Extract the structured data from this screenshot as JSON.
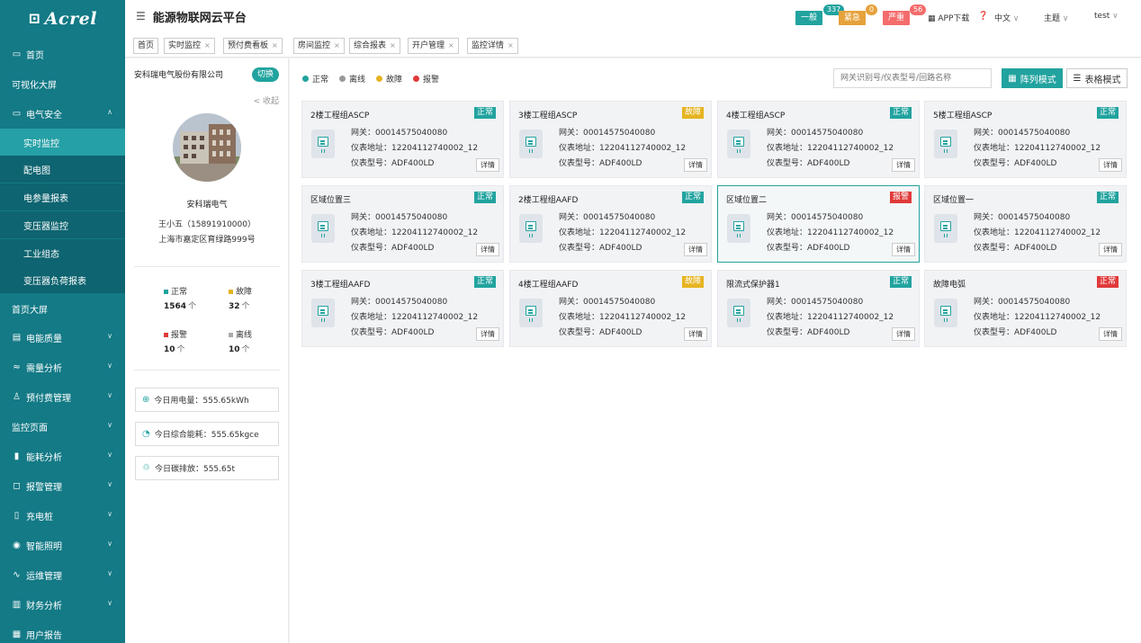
{
  "app": {
    "logo": "Acrel",
    "title": "能源物联网云平台"
  },
  "header": {
    "alarms": [
      {
        "label": "一般",
        "count": "337",
        "color": "#22a39f"
      },
      {
        "label": "紧急",
        "count": "0",
        "color": "#e6a23c"
      },
      {
        "label": "严重",
        "count": "56",
        "color": "#f56c6c"
      }
    ],
    "app_download": "APP下载",
    "language": "中文",
    "theme": "主题",
    "user": "test"
  },
  "sidebar": {
    "items": [
      {
        "label": "首页",
        "icon": "monitor-icon"
      },
      {
        "label": "可视化大屏"
      },
      {
        "label": "电气安全",
        "icon": "monitor-icon",
        "expanded": true
      },
      {
        "label": "实时监控",
        "sub": true,
        "active": true
      },
      {
        "label": "配电图",
        "sub": true
      },
      {
        "label": "电参量报表",
        "sub": true
      },
      {
        "label": "变压器监控",
        "sub": true
      },
      {
        "label": "工业组态",
        "sub": true
      },
      {
        "label": "变压器负荷报表",
        "sub": true
      },
      {
        "label": "首页大屏"
      },
      {
        "label": "电能质量",
        "icon": "wave-icon",
        "chevron": true
      },
      {
        "label": "需量分析",
        "icon": "trend-icon",
        "chevron": true
      },
      {
        "label": "预付费管理",
        "icon": "users-icon",
        "chevron": true
      },
      {
        "label": "监控页面",
        "chevron": true
      },
      {
        "label": "能耗分析",
        "icon": "bar-chart-icon",
        "chevron": true
      },
      {
        "label": "报警管理",
        "icon": "bell-icon",
        "chevron": true
      },
      {
        "label": "充电桩",
        "icon": "charger-icon",
        "chevron": true
      },
      {
        "label": "智能照明",
        "icon": "bulb-icon",
        "chevron": true
      },
      {
        "label": "运维管理",
        "icon": "pulse-icon",
        "chevron": true
      },
      {
        "label": "财务分析",
        "icon": "finance-icon",
        "chevron": true
      },
      {
        "label": "用户报告",
        "icon": "report-icon"
      }
    ]
  },
  "tabs": [
    {
      "label": "首页",
      "closable": false
    },
    {
      "label": "实时监控",
      "closable": true
    },
    {
      "label": "预付费看板",
      "closable": true
    },
    {
      "label": "房间监控",
      "closable": true
    },
    {
      "label": "综合报表",
      "closable": true
    },
    {
      "label": "开户管理",
      "closable": true
    },
    {
      "label": "监控详情",
      "closable": true
    }
  ],
  "left_panel": {
    "company": "安科瑞电气股份有限公司",
    "switch_label": "切换",
    "collapse_label": "< 收起",
    "profile_name": "安科瑞电气",
    "contact": "王小五（15891910000）",
    "address": "上海市嘉定区育绿路999号",
    "stats": [
      {
        "label": "正常",
        "value": "1564",
        "unit": "个",
        "color": "#22a39f"
      },
      {
        "label": "故障",
        "value": "32",
        "unit": "个",
        "color": "#e6b422"
      },
      {
        "label": "报警",
        "value": "10",
        "unit": "个",
        "color": "#e03a3a"
      },
      {
        "label": "离线",
        "value": "10",
        "unit": "个",
        "color": "#aaaaaa"
      }
    ],
    "info": [
      {
        "icon": "power-icon",
        "text": "今日用电量：555.65kWh"
      },
      {
        "icon": "gauge-icon",
        "text": "今日综合能耗：555.65kgce"
      },
      {
        "icon": "leaf-icon",
        "text": "今日碳排放：555.65t"
      }
    ]
  },
  "main": {
    "legend": [
      {
        "label": "正常",
        "color": "#22a39f"
      },
      {
        "label": "离线",
        "color": "#999999"
      },
      {
        "label": "故障",
        "color": "#e6b422"
      },
      {
        "label": "报警",
        "color": "#e03a3a"
      }
    ],
    "search_placeholder": "网关识别号/仪表型号/回路名称",
    "column_mode_label": "阵列模式",
    "table_mode_label": "表格模式",
    "cards": [
      {
        "name": "2楼工程组ASCP",
        "status": "正常",
        "status_color": "#22a39f",
        "gateway": "网关：00014575040080",
        "address": "仪表地址：12204112740002_12",
        "model": "仪表型号：ADF400LD",
        "detail": "详情"
      },
      {
        "name": "3楼工程组ASCP",
        "status": "故障",
        "status_color": "#e6b422",
        "gateway": "网关：00014575040080",
        "address": "仪表地址：12204112740002_12",
        "model": "仪表型号：ADF400LD",
        "detail": "详情"
      },
      {
        "name": "4楼工程组ASCP",
        "status": "正常",
        "status_color": "#22a39f",
        "gateway": "网关：00014575040080",
        "address": "仪表地址：12204112740002_12",
        "model": "仪表型号：ADF400LD",
        "detail": "详情"
      },
      {
        "name": "5楼工程组ASCP",
        "status": "正常",
        "status_color": "#22a39f",
        "gateway": "网关：00014575040080",
        "address": "仪表地址：12204112740002_12",
        "model": "仪表型号：ADF400LD",
        "detail": "详情"
      },
      {
        "name": "区域位置三",
        "status": "正常",
        "status_color": "#22a39f",
        "gateway": "网关：00014575040080",
        "address": "仪表地址：12204112740002_12",
        "model": "仪表型号：ADF400LD",
        "detail": "详情"
      },
      {
        "name": "2楼工程组AAFD",
        "status": "正常",
        "status_color": "#22a39f",
        "gateway": "网关：00014575040080",
        "address": "仪表地址：12204112740002_12",
        "model": "仪表型号：ADF400LD",
        "detail": "详情"
      },
      {
        "name": "区域位置二",
        "status": "报警",
        "status_color": "#e03a3a",
        "gateway": "网关：00014575040080",
        "address": "仪表地址：12204112740002_12",
        "model": "仪表型号：ADF400LD",
        "detail": "详情",
        "highlighted": true
      },
      {
        "name": "区域位置一",
        "status": "正常",
        "status_color": "#22a39f",
        "gateway": "网关：00014575040080",
        "address": "仪表地址：12204112740002_12",
        "model": "仪表型号：ADF400LD",
        "detail": "详情"
      },
      {
        "name": "3楼工程组AAFD",
        "status": "正常",
        "status_color": "#22a39f",
        "gateway": "网关：00014575040080",
        "address": "仪表地址：12204112740002_12",
        "model": "仪表型号：ADF400LD",
        "detail": "详情"
      },
      {
        "name": "4楼工程组AAFD",
        "status": "故障",
        "status_color": "#e6b422",
        "gateway": "网关：00014575040080",
        "address": "仪表地址：12204112740002_12",
        "model": "仪表型号：ADF400LD",
        "detail": "详情"
      },
      {
        "name": "限流式保护器1",
        "status": "正常",
        "status_color": "#22a39f",
        "gateway": "网关：00014575040080",
        "address": "仪表地址：12204112740002_12",
        "model": "仪表型号：ADF400LD",
        "detail": "详情"
      },
      {
        "name": "故障电弧",
        "status": "正常",
        "status_color": "#e03a3a",
        "gateway": "网关：00014575040080",
        "address": "仪表地址：12204112740002_12",
        "model": "仪表型号：ADF400LD",
        "detail": "详情"
      }
    ]
  }
}
